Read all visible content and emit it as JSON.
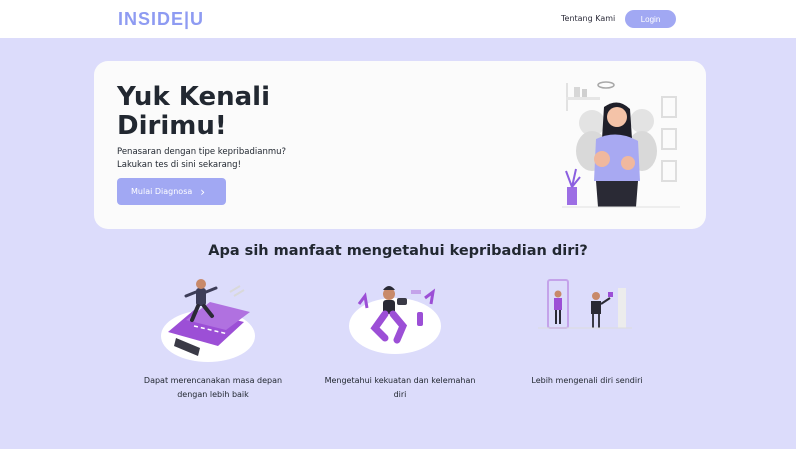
{
  "nav": {
    "logo": "INSIDE|U",
    "about_link": "Tentang Kami",
    "login_label": "Login"
  },
  "hero": {
    "title": "Yuk Kenali Dirimu!",
    "line1": "Penasaran dengan tipe kepribadianmu?",
    "line2": "Lakukan tes di sini sekarang!",
    "cta_label": "Mulai Diagnosa",
    "cta_icon": "chevron-right-icon"
  },
  "benefits": {
    "title": "Apa sih manfaat mengetahui kepribadian diri?",
    "items": [
      {
        "caption": "Dapat merencanakan masa depan dengan lebih baik",
        "icon": "running-future-illustration"
      },
      {
        "caption": "Mengetahui kekuatan dan kelemahan diri",
        "icon": "workout-strength-illustration"
      },
      {
        "caption": "Lebih mengenali diri sendiri",
        "icon": "mirror-self-illustration"
      }
    ]
  },
  "colors": {
    "background": "#dcdcfb",
    "accent": "#a1a8f3",
    "logo": "#8e9bf2",
    "illustration_purple": "#9c4fd6"
  }
}
